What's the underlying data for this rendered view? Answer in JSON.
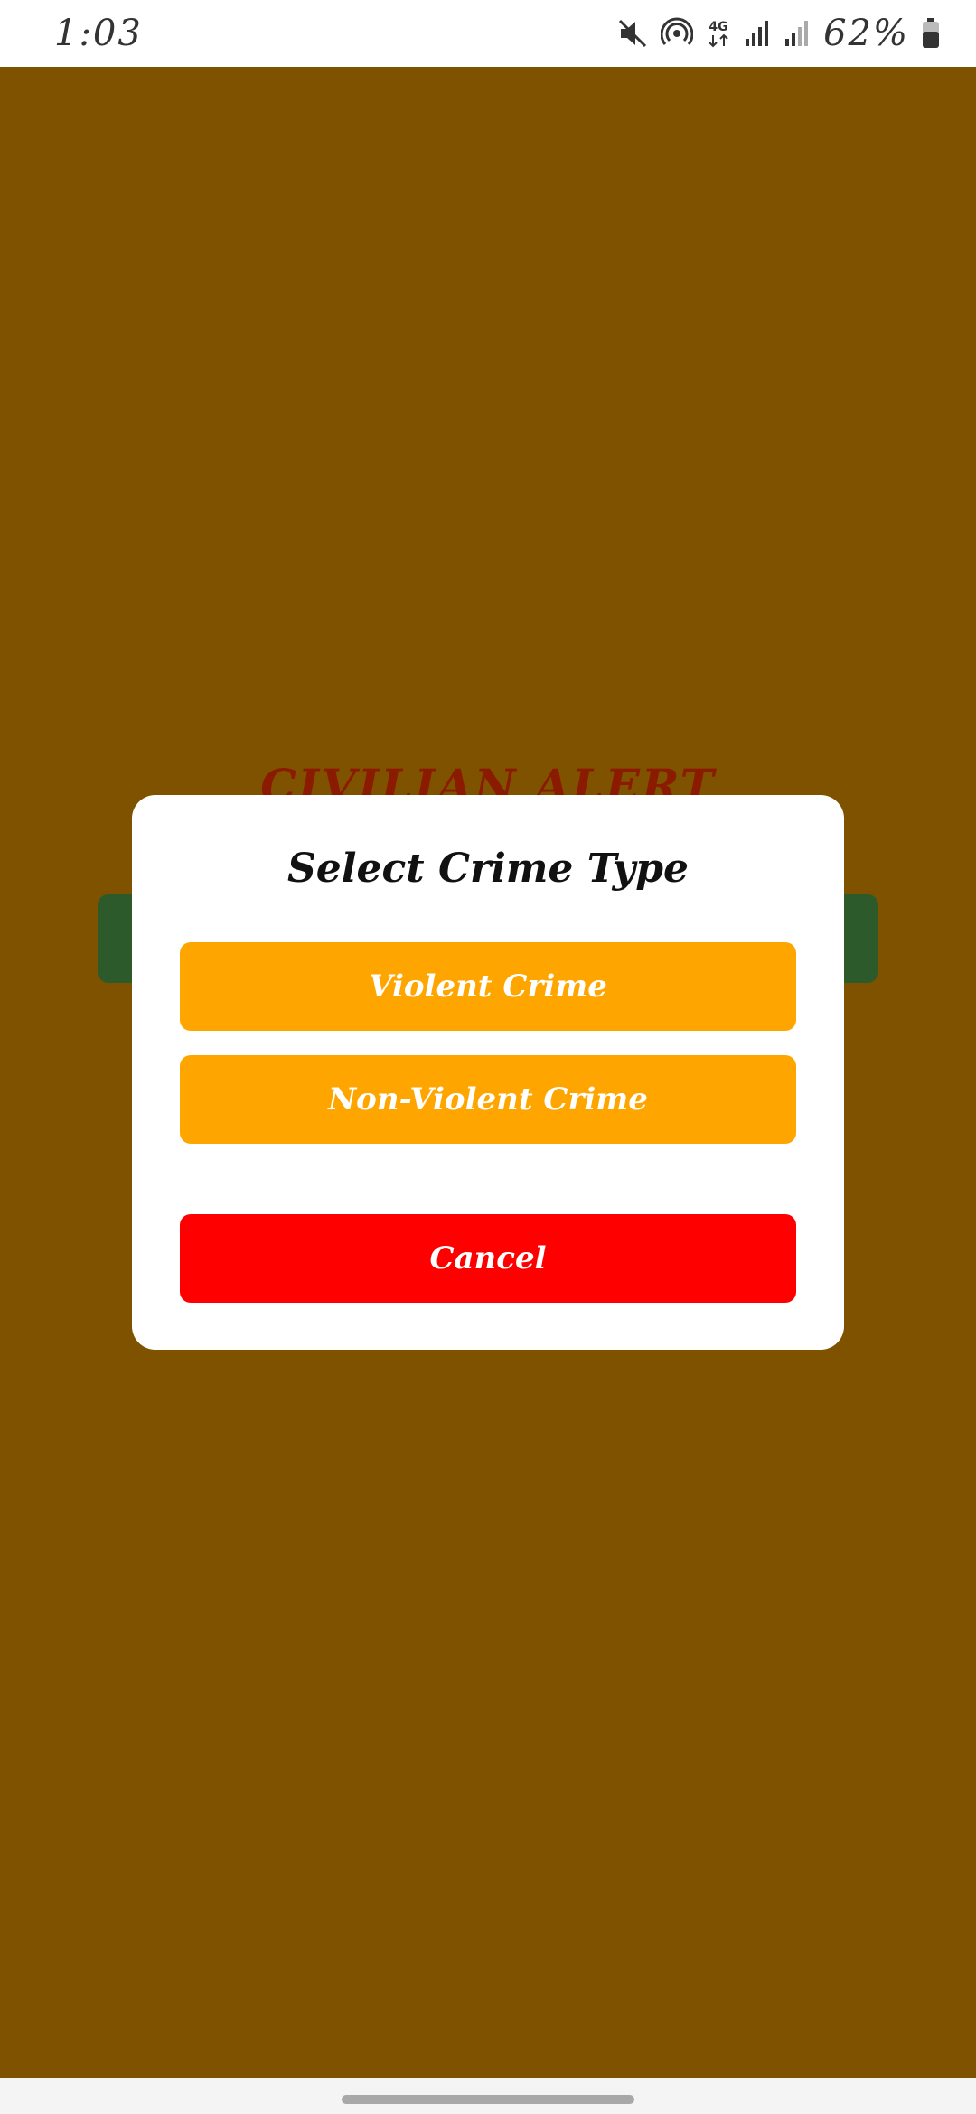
{
  "status_bar": {
    "time": "1:03",
    "battery": "62%",
    "icons": [
      "mute-icon",
      "hotspot-icon",
      "4g-icon",
      "signal-icon",
      "signal-weak-icon",
      "battery-icon"
    ],
    "network_label": "4G"
  },
  "background": {
    "title": "CIVILIAN ALERT"
  },
  "dialog": {
    "title": "Select Crime Type",
    "violent_label": "Violent Crime",
    "nonviolent_label": "Non-Violent Crime",
    "cancel_label": "Cancel"
  },
  "colors": {
    "scrim_background": "#7f5200",
    "option_button": "#ffa500",
    "cancel_button": "#ff0000",
    "bg_button": "#2c5a2b",
    "bg_title": "#8a1a00"
  }
}
